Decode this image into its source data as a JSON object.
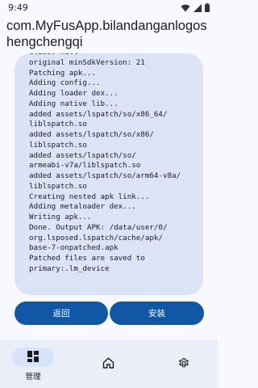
{
  "status_bar": {
    "time": "9:49",
    "icons": [
      "wifi-icon",
      "cellular-signal-icon",
      "battery-icon"
    ]
  },
  "app": {
    "title": "com.MyFusApp.bilandanganlogoshengchengqi"
  },
  "log": {
    "lines": [
      "class: null",
      "original minSdkVersion: 21",
      "Patching apk...",
      "Adding config...",
      "Adding loader dex...",
      "Adding native lib...",
      "added assets/lspatch/so/x86_64/",
      "liblspatch.so",
      "added assets/lspatch/so/x86/",
      "liblspatch.so",
      "added assets/lspatch/so/",
      "armeabi-v7a/liblspatch.so",
      "added assets/lspatch/so/arm64-v8a/",
      "liblspatch.so",
      "Creating nested apk link...",
      "Adding metaloader dex...",
      "Writing apk...",
      "Done. Output APK: /data/user/0/",
      "org.lsposed.lspatch/cache/apk/",
      "base-7-onpatched.apk",
      "Patched files are saved to",
      "primary:.lm_device"
    ],
    "text": ""
  },
  "actions": {
    "back_label": "返回",
    "install_label": "安装"
  },
  "bottom_nav": {
    "items": [
      {
        "label": "管理",
        "icon": "dashboard-grid-icon",
        "selected": true
      },
      {
        "label": "",
        "icon": "home-icon",
        "selected": false
      },
      {
        "label": "",
        "icon": "settings-gear-icon",
        "selected": false
      }
    ]
  },
  "colors": {
    "background": "#f7f9ff",
    "card": "#dde3f6",
    "accent": "#1256a6",
    "nav_bar": "#eaeef8",
    "nav_pill": "#d6e3fb"
  }
}
